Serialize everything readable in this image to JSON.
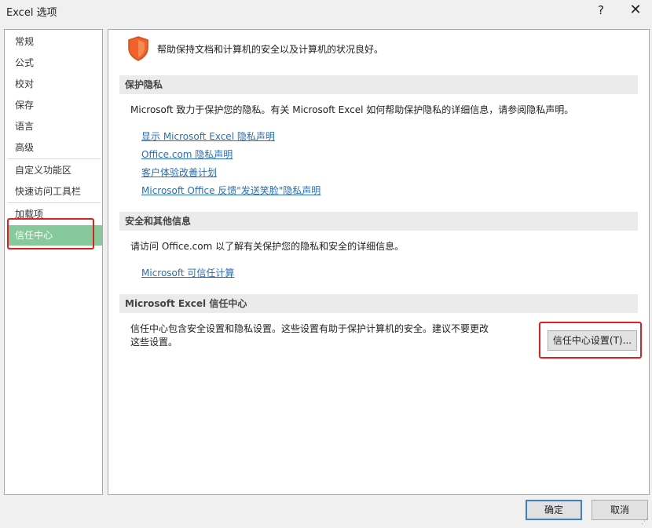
{
  "window": {
    "title": "Excel 选项",
    "help_label": "?",
    "close_label": "✕"
  },
  "sidebar": {
    "items": [
      {
        "label": "常规"
      },
      {
        "label": "公式"
      },
      {
        "label": "校对"
      },
      {
        "label": "保存"
      },
      {
        "label": "语言"
      },
      {
        "label": "高级"
      },
      {
        "label": "自定义功能区"
      },
      {
        "label": "快速访问工具栏"
      },
      {
        "label": "加载项"
      },
      {
        "label": "信任中心"
      }
    ],
    "active": "信任中心",
    "active_color": "#86c99a"
  },
  "main": {
    "intro": "帮助保持文档和计算机的安全以及计算机的状况良好。",
    "shield_icon": "shield-icon",
    "shield_color": "#f0622a",
    "sections": [
      {
        "header": "保护隐私",
        "text": "Microsoft 致力于保护您的隐私。有关 Microsoft Excel 如何帮助保护隐私的详细信息，请参阅隐私声明。",
        "links": [
          "显示 Microsoft Excel 隐私声明",
          "Office.com 隐私声明",
          "客户体验改善计划",
          "Microsoft Office 反馈\"发送笑脸\"隐私声明"
        ]
      },
      {
        "header": "安全和其他信息",
        "text": "请访问 Office.com 以了解有关保护您的隐私和安全的详细信息。",
        "links": [
          "Microsoft 可信任计算"
        ]
      },
      {
        "header": "Microsoft Excel 信任中心",
        "text_line1": "信任中心包含安全设置和隐私设置。这些设置有助于保护计算机的安全。建议不要更改",
        "text_line2": "这些设置。",
        "button": "信任中心设置(T)..."
      }
    ],
    "link_color": "#2a6ebb"
  },
  "footer": {
    "ok": "确定",
    "cancel": "取消"
  },
  "highlight_color": "#e02020"
}
